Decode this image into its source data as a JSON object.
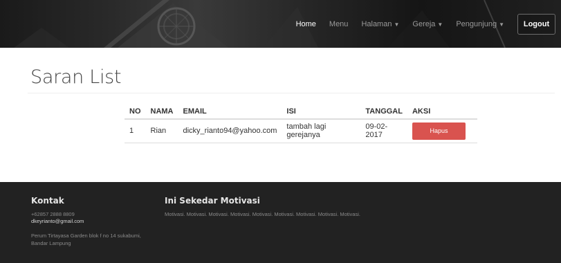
{
  "nav": {
    "items": [
      {
        "label": "Home",
        "active": true
      },
      {
        "label": "Menu",
        "active": false
      },
      {
        "label": "Halaman",
        "dropdown": true
      },
      {
        "label": "Gereja",
        "dropdown": true
      },
      {
        "label": "Pengunjung",
        "dropdown": true
      }
    ],
    "logout_label": "Logout"
  },
  "page": {
    "title": "Saran List"
  },
  "table": {
    "headers": [
      "NO",
      "NAMA",
      "EMAIL",
      "ISI",
      "TANGGAL",
      "AKSI"
    ],
    "rows": [
      {
        "no": "1",
        "nama": "Rian",
        "email": "dicky_rianto94@yahoo.com",
        "isi": "tambah lagi gerejanya",
        "tanggal": "09-02-2017",
        "aksi": "Hapus"
      }
    ]
  },
  "footer": {
    "kontak": {
      "heading": "Kontak",
      "phone": "+62857 2888 8809",
      "email": "dkeyrianto@gmail.com",
      "address": "Perum Tirtayasa Garden blok f no 14 sukabumi, Bandar Lampung"
    },
    "motivasi": {
      "heading": "Ini Sekedar Motivasi",
      "text": "Motivasi. Motivasi. Motivasi. Motivasi. Motivasi. Motivasi. Motivasi. Motivasi. Motivasi."
    }
  },
  "colors": {
    "danger_button": "#d9534f",
    "footer_bg": "#222222",
    "header_bg": "#262626"
  }
}
